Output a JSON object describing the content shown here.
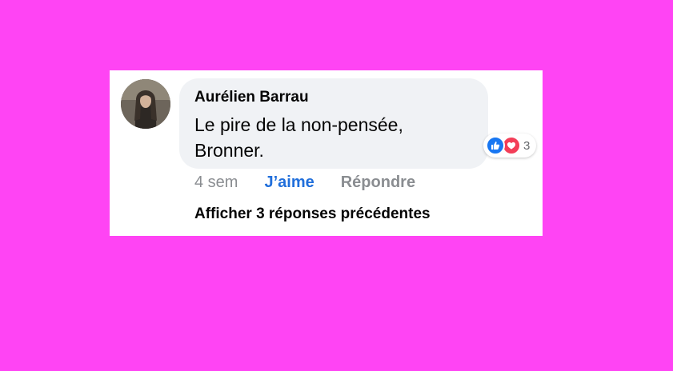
{
  "comment": {
    "author": "Aurélien Barrau",
    "text": "Le pire de la non-pensée, Bronner.",
    "reactions": {
      "count": "3",
      "icons": [
        "like-icon",
        "love-icon"
      ],
      "colors": {
        "like": "#1877f2",
        "love": "#f33e58"
      }
    },
    "actions": {
      "time": "4 sem",
      "like_label": "J’aime",
      "reply_label": "Répondre"
    },
    "previous_replies_label": "Afficher 3 réponses précédentes"
  },
  "colors": {
    "background": "#ff44f4",
    "bubble": "#f0f2f5",
    "link_blue": "#216fdb",
    "muted": "#8a8d91"
  }
}
